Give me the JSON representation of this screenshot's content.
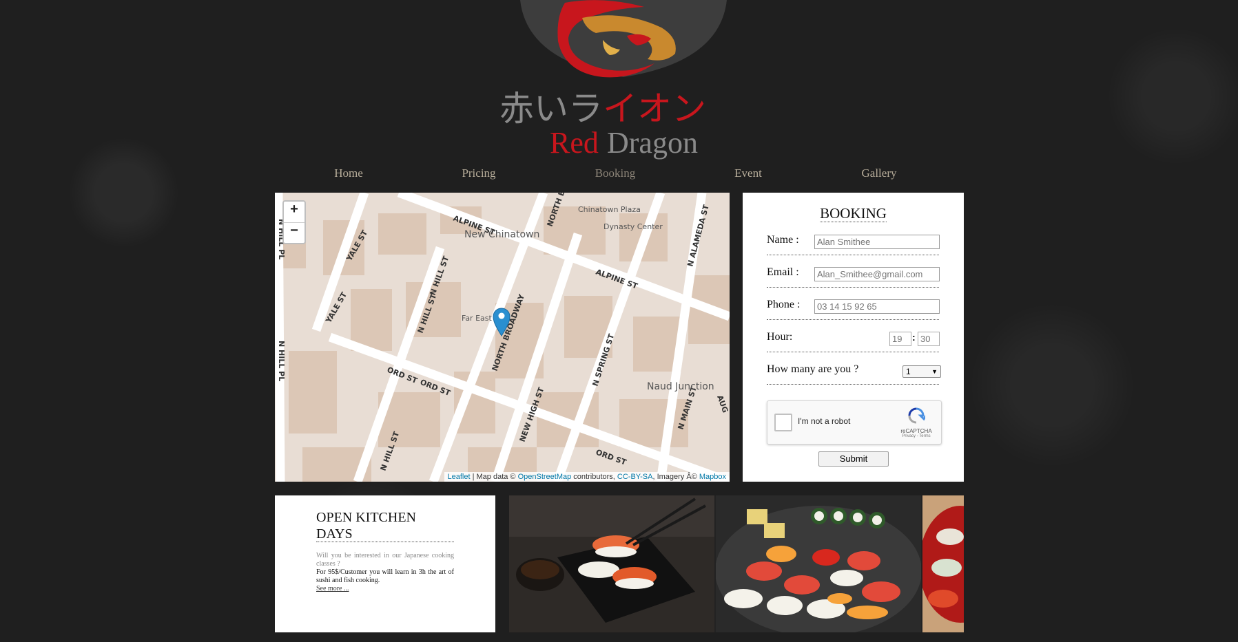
{
  "brand": {
    "jp_name": "赤いライオン",
    "name_part1": "Red",
    "name_part2": "Dragon"
  },
  "nav": {
    "items": [
      "Home",
      "Pricing",
      "Booking",
      "Event",
      "Gallery"
    ],
    "active": "Booking"
  },
  "map": {
    "zoom_in": "+",
    "zoom_out": "−",
    "street_labels": [
      "ALPINE ST",
      "ALPINE ST",
      "NORTH BROADWAY",
      "N HILL ST",
      "N HILL ST",
      "N HILL ST",
      "YALE ST",
      "YALE ST",
      "ORD ST",
      "ORD ST",
      "ORD ST",
      "NEW HIGH ST",
      "N SPRING ST",
      "N ALAMEDA ST",
      "N MAIN ST",
      "N HILL PL",
      "N HILL PL",
      "NORTH B",
      "AUG"
    ],
    "place_labels": [
      "New Chinatown",
      "Chinatown Plaza",
      "Dynasty Center",
      "Far East P",
      "Naud Junction"
    ],
    "attribution": {
      "leaflet": "Leaflet",
      "sep1": " | Map data © ",
      "osm": "OpenStreetMap",
      "sep2": " contributors, ",
      "license": "CC-BY-SA",
      "sep3": ", Imagery Â© ",
      "provider": "Mapbox"
    }
  },
  "booking": {
    "title": "BOOKING",
    "name_label": "Name :",
    "name_placeholder": "Alan Smithee",
    "email_label": "Email :",
    "email_placeholder": "Alan_Smithee@gmail.com",
    "phone_label": "Phone :",
    "phone_placeholder": "03 14 15 92 65",
    "hour_label": "Hour:",
    "hour_placeholder": "19",
    "minute_placeholder": "30",
    "hour_sep": ":",
    "guests_label": "How many are you ?",
    "guests_value": "1",
    "captcha_text": "I'm not a robot",
    "captcha_brand": "reCAPTCHA",
    "captcha_links": "Privacy - Terms",
    "submit_label": "Submit"
  },
  "kitchen": {
    "title": "OPEN KITCHEN DAYS",
    "intro": "Will you be interested in our Japanese cooking classes ?",
    "details": "For 95$/Customer you will learn in 3h the art of sushi and fish cooking.",
    "more": "See more ..."
  },
  "colors": {
    "background": "#1f1f1f",
    "brand_red": "#c8161d",
    "brand_grey": "#8a8a8a",
    "nav_text": "#b7ad9a",
    "map_marker": "#2a8fd0",
    "link_blue": "#0078a8"
  }
}
